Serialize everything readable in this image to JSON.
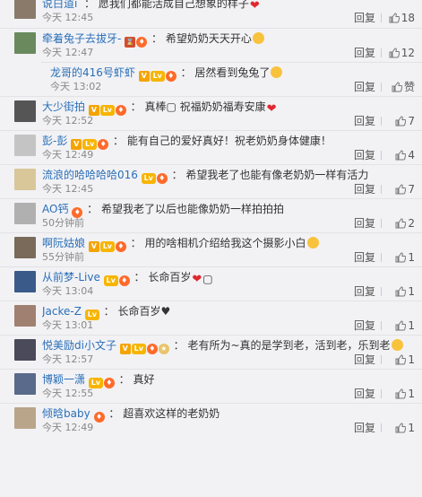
{
  "comments": [
    {
      "name": "说白道i",
      "badges": [],
      "text": "愿我们都能活成自己想象的样子",
      "emoji": [
        "heart"
      ],
      "time": "今天 12:45",
      "reply_label": "回复",
      "likes": "18",
      "avatar": "#8a7a6a",
      "reply": false
    },
    {
      "name": "牵着兔子去拔牙-",
      "badges": [
        "hg",
        "flame"
      ],
      "text": "希望奶奶天天开心",
      "emoji": [
        "face"
      ],
      "time": "今天 12:47",
      "reply_label": "回复",
      "likes": "12",
      "avatar": "#6a8a5e",
      "reply": false
    },
    {
      "name": "龙哥的416号虾虾",
      "badges": [
        "v",
        "lv",
        "flame"
      ],
      "text": "居然看到兔兔了",
      "emoji": [
        "face"
      ],
      "time": "今天 13:02",
      "reply_label": "回复",
      "likes": "赞",
      "avatar": "#999999",
      "reply": true
    },
    {
      "name": "大少街拍",
      "badges": [
        "v",
        "lv",
        "flame"
      ],
      "text": "真棒▢ 祝福奶奶福寿安康",
      "emoji": [
        "heart"
      ],
      "time": "今天 12:52",
      "reply_label": "回复",
      "likes": "7",
      "avatar": "#555555",
      "reply": false
    },
    {
      "name": "彭-彭",
      "badges": [
        "v",
        "lv",
        "flame"
      ],
      "text": "能有自己的爱好真好！祝老奶奶身体健康！",
      "emoji": [],
      "time": "今天 12:49",
      "reply_label": "回复",
      "likes": "4",
      "avatar": "#c4c4c4",
      "reply": false
    },
    {
      "name": "流浪的哈哈哈哈016",
      "badges": [
        "lv",
        "flame"
      ],
      "text": "希望我老了也能有像老奶奶一样有活力",
      "emoji": [],
      "time": "今天 12:45",
      "reply_label": "回复",
      "likes": "7",
      "avatar": "#d9c79a",
      "reply": false
    },
    {
      "name": "AO钙",
      "badges": [
        "flame"
      ],
      "text": "希望我老了以后也能像奶奶一样拍拍拍",
      "emoji": [],
      "time": "50分钟前",
      "reply_label": "回复",
      "likes": "2",
      "avatar": "#b0b0b0",
      "reply": false
    },
    {
      "name": "啊阮姑娘",
      "badges": [
        "v",
        "lv",
        "flame"
      ],
      "text": "用的啥相机介绍给我这个摄影小白",
      "emoji": [
        "face"
      ],
      "time": "55分钟前",
      "reply_label": "回复",
      "likes": "1",
      "avatar": "#7a6a5a",
      "reply": false
    },
    {
      "name": "从前梦-Live",
      "badges": [
        "lv",
        "flame"
      ],
      "text": "长命百岁",
      "emoji": [
        "heart",
        "box"
      ],
      "time": "今天 13:04",
      "reply_label": "回复",
      "likes": "1",
      "avatar": "#3a5a8a",
      "reply": false
    },
    {
      "name": "Jacke-Z",
      "badges": [
        "lv"
      ],
      "text": "长命百岁♥",
      "emoji": [],
      "time": "今天 13:01",
      "reply_label": "回复",
      "likes": "1",
      "avatar": "#a08070",
      "reply": false
    },
    {
      "name": "悦美励di小文子",
      "badges": [
        "v",
        "lv",
        "flame",
        "medal"
      ],
      "text": "老有所为~真的是学到老，活到老，乐到老",
      "emoji": [
        "face"
      ],
      "time": "今天 12:57",
      "reply_label": "回复",
      "likes": "1",
      "avatar": "#4a4a5a",
      "reply": false
    },
    {
      "name": "博颖一潇",
      "badges": [
        "lv",
        "flame"
      ],
      "text": "真好",
      "emoji": [],
      "time": "今天 12:55",
      "reply_label": "回复",
      "likes": "1",
      "avatar": "#5a6a8a",
      "reply": false
    },
    {
      "name": "倾晗baby",
      "badges": [
        "flame"
      ],
      "text": "超喜欢这样的老奶奶",
      "emoji": [],
      "time": "今天 12:49",
      "reply_label": "回复",
      "likes": "1",
      "avatar": "#b9a58a",
      "reply": false
    }
  ]
}
